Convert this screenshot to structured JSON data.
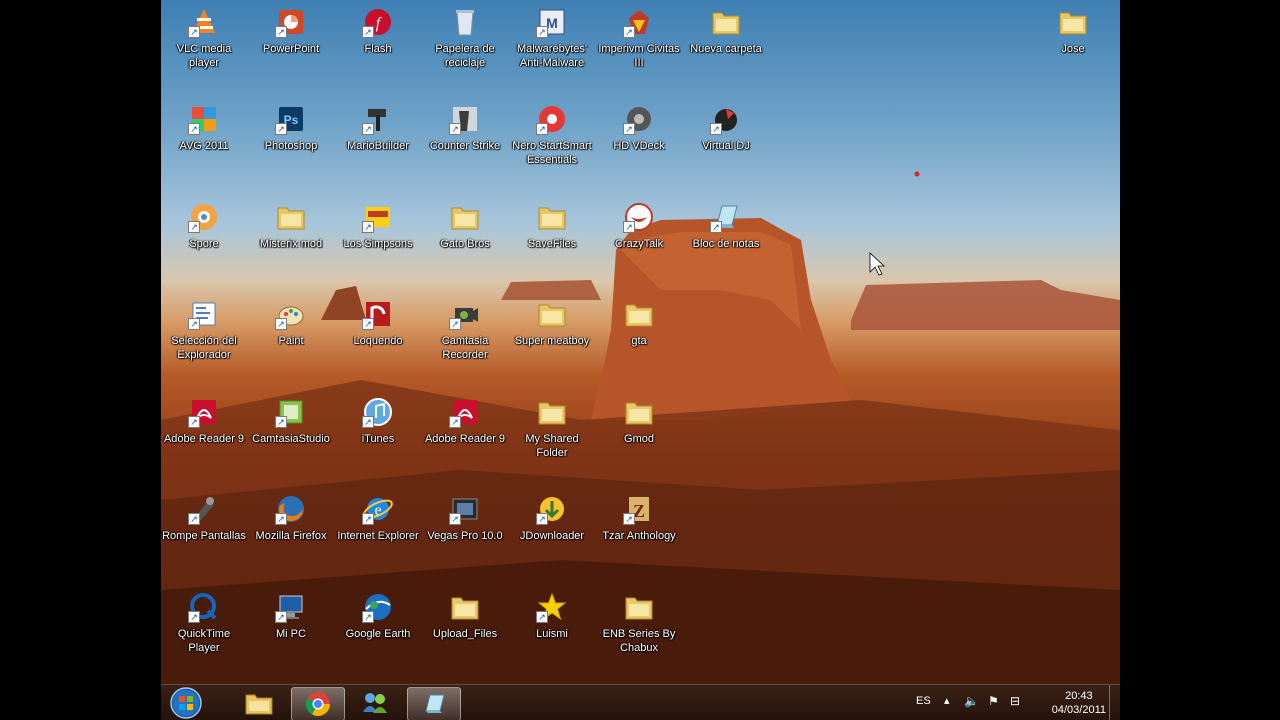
{
  "desktop": {
    "icons": [
      {
        "label": "VLC media player",
        "icon": "vlc-icon"
      },
      {
        "label": "PowerPoint",
        "icon": "powerpoint-icon"
      },
      {
        "label": "Flash",
        "icon": "flash-icon"
      },
      {
        "label": "Papelera de reciclaje",
        "icon": "recycle-bin-icon"
      },
      {
        "label": "Malwarebytes' Anti-Malware",
        "icon": "malwarebytes-icon"
      },
      {
        "label": "Imperivm Civitas III",
        "icon": "imperivm-icon"
      },
      {
        "label": "Nueva carpeta",
        "icon": "folder-icon"
      },
      {
        "label": "Jose",
        "icon": "folder-icon"
      },
      {
        "label": "AVG 2011",
        "icon": "avg-icon"
      },
      {
        "label": "Photoshop",
        "icon": "photoshop-icon"
      },
      {
        "label": "MarioBuilder",
        "icon": "hammer-icon"
      },
      {
        "label": "Counter Strike",
        "icon": "counter-strike-icon"
      },
      {
        "label": "Nero StartSmart Essentials",
        "icon": "nero-icon"
      },
      {
        "label": "HD VDeck",
        "icon": "vdeck-icon"
      },
      {
        "label": "Virtual DJ",
        "icon": "virtual-dj-icon"
      },
      {
        "label": "Spore",
        "icon": "spore-icon"
      },
      {
        "label": "Misterix mod",
        "icon": "folder-icon"
      },
      {
        "label": "Los Simpsons",
        "icon": "simpsons-icon"
      },
      {
        "label": "Gato Bros",
        "icon": "folder-icon"
      },
      {
        "label": "SaveFiles",
        "icon": "folder-icon"
      },
      {
        "label": "CrazyTalk",
        "icon": "crazytalk-icon"
      },
      {
        "label": "Bloc de notas",
        "icon": "notepad-icon"
      },
      {
        "label": "Selección del Explorador",
        "icon": "explorer-selection-icon"
      },
      {
        "label": "Paint",
        "icon": "paint-icon"
      },
      {
        "label": "Loquendo",
        "icon": "loquendo-icon"
      },
      {
        "label": "Camtasia Recorder",
        "icon": "camtasia-recorder-icon"
      },
      {
        "label": "Super meatboy",
        "icon": "folder-icon"
      },
      {
        "label": "gta",
        "icon": "folder-icon"
      },
      {
        "label": "Adobe Reader 9",
        "icon": "adobe-reader-icon"
      },
      {
        "label": "CamtasiaStudio",
        "icon": "camtasia-studio-icon"
      },
      {
        "label": "iTunes",
        "icon": "itunes-icon"
      },
      {
        "label": "Adobe Reader 9",
        "icon": "adobe-reader-icon"
      },
      {
        "label": "My Shared Folder",
        "icon": "folder-icon"
      },
      {
        "label": "Gmod",
        "icon": "folder-icon"
      },
      {
        "label": "Rompe Pantallas",
        "icon": "screen-breaker-icon"
      },
      {
        "label": "Mozilla Firefox",
        "icon": "firefox-icon"
      },
      {
        "label": "Internet Explorer",
        "icon": "internet-explorer-icon"
      },
      {
        "label": "Vegas Pro 10.0",
        "icon": "vegas-icon"
      },
      {
        "label": "JDownloader",
        "icon": "jdownloader-icon"
      },
      {
        "label": "Tzar Anthology",
        "icon": "tzar-icon"
      },
      {
        "label": "QuickTime Player",
        "icon": "quicktime-icon"
      },
      {
        "label": "Mi PC",
        "icon": "computer-icon"
      },
      {
        "label": "Google Earth",
        "icon": "google-earth-icon"
      },
      {
        "label": "Upload_Files",
        "icon": "folder-icon"
      },
      {
        "label": "Luismi",
        "icon": "star-icon"
      },
      {
        "label": "ENB Series By Chabux",
        "icon": "folder-icon"
      }
    ]
  },
  "taskbar": {
    "start": "start-orb-icon",
    "pinned": [
      {
        "name": "explorer",
        "icon": "explorer-folder-icon",
        "active": false
      },
      {
        "name": "chrome",
        "icon": "chrome-icon",
        "active": true
      },
      {
        "name": "messenger",
        "icon": "messenger-icon",
        "active": false
      },
      {
        "name": "notepad",
        "icon": "notepad-icon",
        "active": true
      }
    ],
    "tray": {
      "language": "ES",
      "time": "20:43",
      "date": "04/03/2011"
    }
  },
  "colors": {
    "folder": "#e8c766",
    "accent": "#2a6fc1"
  }
}
